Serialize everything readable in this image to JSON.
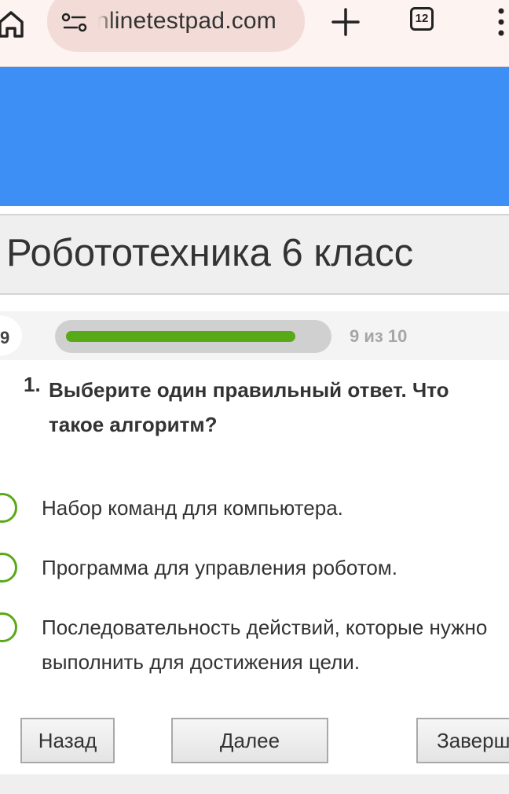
{
  "browser": {
    "url_text": "nlinetestpad.com",
    "tab_count": "12",
    "icons": [
      "home-icon",
      "site-info-icon",
      "plus-icon",
      "tabs-icon",
      "more-vertical-icon"
    ]
  },
  "colors": {
    "banner": "#3d8ff5",
    "accent_green": "#58a918",
    "toolbar_bg": "#fdf3f1",
    "url_pill_bg": "#f3dcd7"
  },
  "test": {
    "title": "Робототехника 6 класс"
  },
  "progress": {
    "step_badge": "9",
    "label": "9 из 10",
    "fraction": 0.9
  },
  "question": {
    "number": "1.",
    "text": "Выберите один правильный ответ. Что такое алгоритм?",
    "answers": [
      "Набор команд для компьютера.",
      "Программа для управления роботом.",
      "Последовательность действий, которые нужно выполнить для достижения цели."
    ]
  },
  "buttons": {
    "back": "Назад",
    "next": "Далее",
    "finish": "Заверш"
  }
}
